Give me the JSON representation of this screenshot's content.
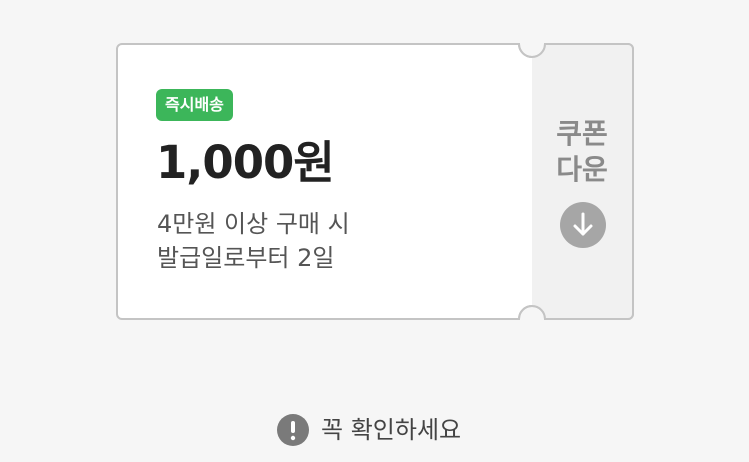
{
  "coupon": {
    "badge": "즉시배송",
    "amount": "1,000원",
    "condition_line1": "4만원 이상 구매 시",
    "condition_line2": "발급일로부터 2일",
    "download_line1": "쿠폰",
    "download_line2": "다운",
    "download_icon": "arrow-down-circle-icon"
  },
  "notice": {
    "icon": "exclamation-circle-icon",
    "text": "꼭 확인하세요"
  },
  "colors": {
    "background": "#f6f6f6",
    "badge": "#3cb65a",
    "card": "#ffffff",
    "stub": "#f1f1f1",
    "border": "#c4c4c4",
    "icon_gray": "#a6a6a6",
    "notice_icon": "#7a7a7a"
  }
}
